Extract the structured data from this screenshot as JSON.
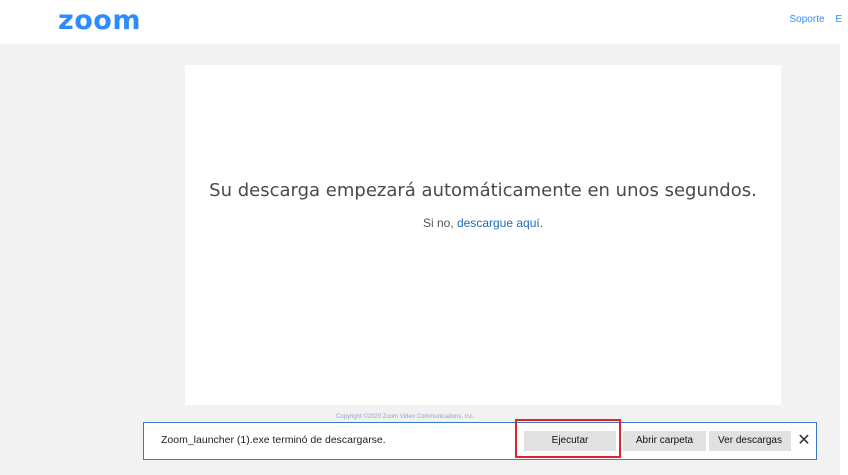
{
  "header": {
    "logo": "zoom",
    "nav": [
      "Soporte",
      "E"
    ]
  },
  "card": {
    "message": "Su descarga empezará automáticamente en unos segundos.",
    "sub_prefix": "Si no, ",
    "sub_link": "descargue aquí",
    "sub_suffix": "."
  },
  "footer": {
    "copyright": "Copyright ©2020 Zoom Video Communications, Inc."
  },
  "download_bar": {
    "message": "Zoom_launcher (1).exe terminó de descargarse.",
    "run_label": "Ejecutar",
    "open_folder_label": "Abrir carpeta",
    "view_downloads_label": "Ver descargas",
    "close_glyph": "✕"
  },
  "colors": {
    "brand": "#2d8cff",
    "link": "#1f6bb5",
    "page_background": "#f2f2f2",
    "download_bar_border": "#3c78c8",
    "highlight": "#e0232d"
  },
  "icons": {
    "close": "close-icon"
  }
}
